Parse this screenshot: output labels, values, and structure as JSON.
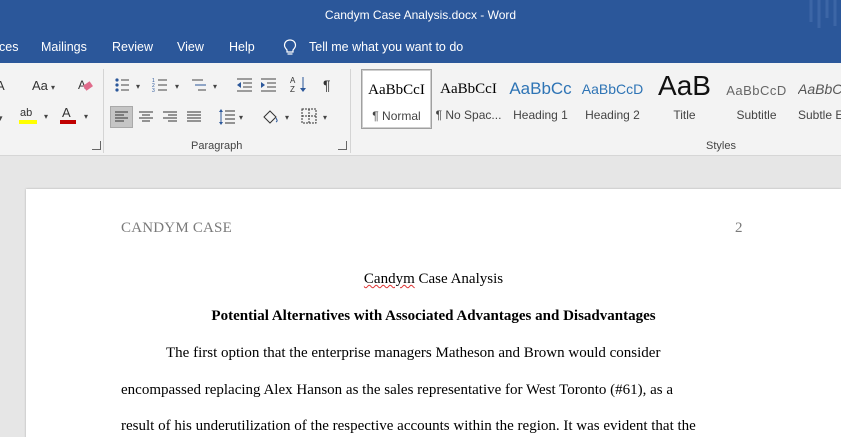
{
  "window": {
    "title": "Candym Case Analysis.docx  -  Word"
  },
  "menu": {
    "tabs": [
      "ces",
      "Mailings",
      "Review",
      "View",
      "Help"
    ],
    "tell_me": "Tell me what you want to do"
  },
  "ribbon": {
    "paragraph_label": "Paragraph",
    "styles_label": "Styles",
    "font_case": "Aa",
    "styles": [
      {
        "sample": "AaBbCcI",
        "name": "¶ Normal"
      },
      {
        "sample": "AaBbCcI",
        "name": "¶ No Spac..."
      },
      {
        "sample": "AaBbCc",
        "name": "Heading 1"
      },
      {
        "sample": "AaBbCcD",
        "name": "Heading 2"
      },
      {
        "sample": "AaB",
        "name": "Title"
      },
      {
        "sample": "AaBbCcD",
        "name": "Subtitle"
      },
      {
        "sample": "AaBbC",
        "name": "Subtle E"
      }
    ]
  },
  "document": {
    "header_left": "CANDYM CASE",
    "page_number": "2",
    "title_word": "Candym",
    "title_rest": " Case Analysis",
    "heading": "Potential Alternatives with Associated Advantages and Disadvantages",
    "lines": [
      "The first option that the enterprise managers Matheson and Brown would consider",
      "encompassed replacing Alex Hanson as the sales representative for West Toronto (#61), as a",
      "result of his underutilization of the respective accounts within the region. It was evident that the"
    ]
  }
}
